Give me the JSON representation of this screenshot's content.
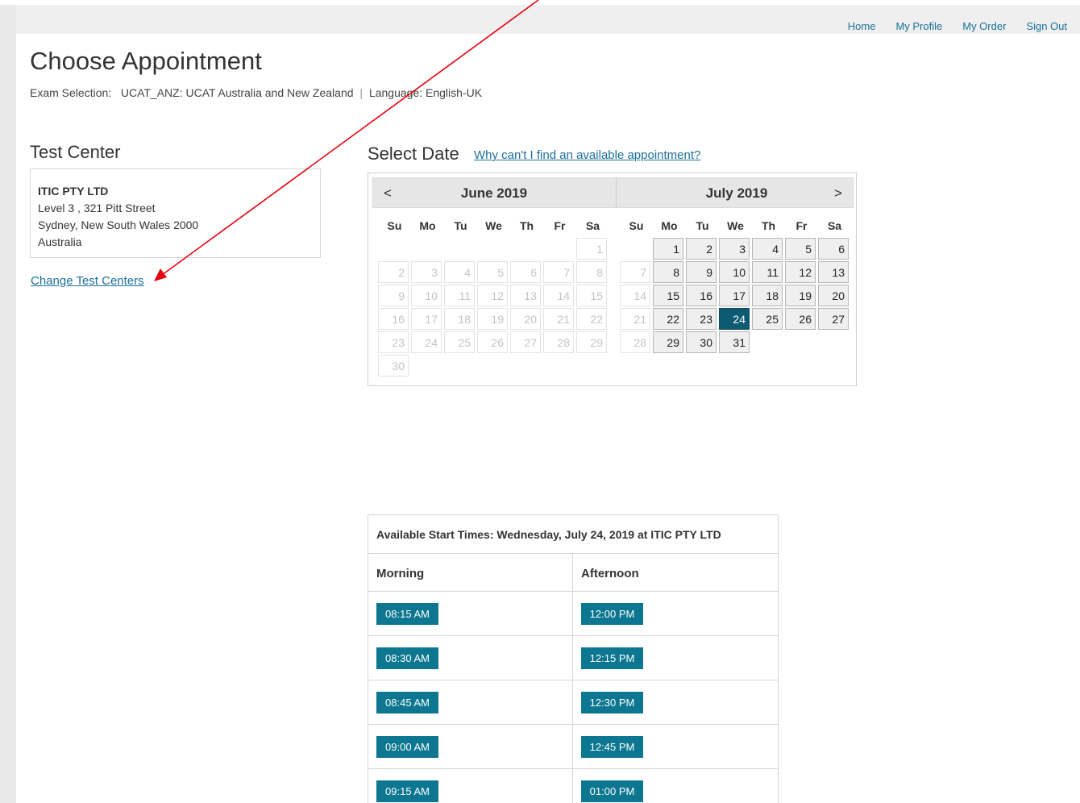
{
  "nav": [
    "Home",
    "My Profile",
    "My Order",
    "Sign Out"
  ],
  "page_title": "Choose Appointment",
  "exam": {
    "label": "Exam Selection:",
    "value": "UCAT_ANZ: UCAT Australia and New Zealand",
    "separator": "|",
    "language": "Language: English-UK"
  },
  "test_center": {
    "heading": "Test Center",
    "name": "ITIC PTY LTD",
    "address1": "Level 3 , 321 Pitt Street",
    "address2": "Sydney, New South Wales 2000",
    "country": "Australia",
    "change_link": "Change Test Centers"
  },
  "select_date": {
    "heading": "Select Date",
    "help_link": "Why can't I find an available appointment?",
    "prev": "<",
    "next": ">",
    "weekdays": [
      "Su",
      "Mo",
      "Tu",
      "We",
      "Th",
      "Fr",
      "Sa"
    ],
    "months": [
      {
        "title": "June 2019",
        "weeks": [
          [
            0,
            0,
            0,
            0,
            0,
            0,
            1
          ],
          [
            2,
            3,
            4,
            5,
            6,
            7,
            8
          ],
          [
            9,
            10,
            11,
            12,
            13,
            14,
            15
          ],
          [
            16,
            17,
            18,
            19,
            20,
            21,
            22
          ],
          [
            23,
            24,
            25,
            26,
            27,
            28,
            29
          ],
          [
            30,
            0,
            0,
            0,
            0,
            0,
            0
          ]
        ],
        "available": [],
        "selected": null
      },
      {
        "title": "July 2019",
        "weeks": [
          [
            0,
            1,
            2,
            3,
            4,
            5,
            6
          ],
          [
            7,
            8,
            9,
            10,
            11,
            12,
            13
          ],
          [
            14,
            15,
            16,
            17,
            18,
            19,
            20
          ],
          [
            21,
            22,
            23,
            24,
            25,
            26,
            27
          ],
          [
            28,
            29,
            30,
            31,
            0,
            0,
            0
          ]
        ],
        "available": [
          1,
          2,
          3,
          4,
          5,
          6,
          8,
          9,
          10,
          11,
          12,
          13,
          15,
          16,
          17,
          18,
          19,
          20,
          22,
          23,
          24,
          25,
          26,
          27,
          29,
          30,
          31
        ],
        "selected": 24
      }
    ]
  },
  "times": {
    "caption": "Available Start Times: Wednesday, July 24, 2019 at ITIC PTY LTD",
    "morning_label": "Morning",
    "afternoon_label": "Afternoon",
    "morning": [
      "08:15 AM",
      "08:30 AM",
      "08:45 AM",
      "09:00 AM",
      "09:15 AM"
    ],
    "afternoon": [
      "12:00 PM",
      "12:15 PM",
      "12:30 PM",
      "12:45 PM",
      "01:00 PM"
    ]
  },
  "colors": {
    "link": "#1a6f9a",
    "selected_day": "#0d5a73",
    "time_button": "#0d7791",
    "annotation_arrow": "#e8000d"
  }
}
